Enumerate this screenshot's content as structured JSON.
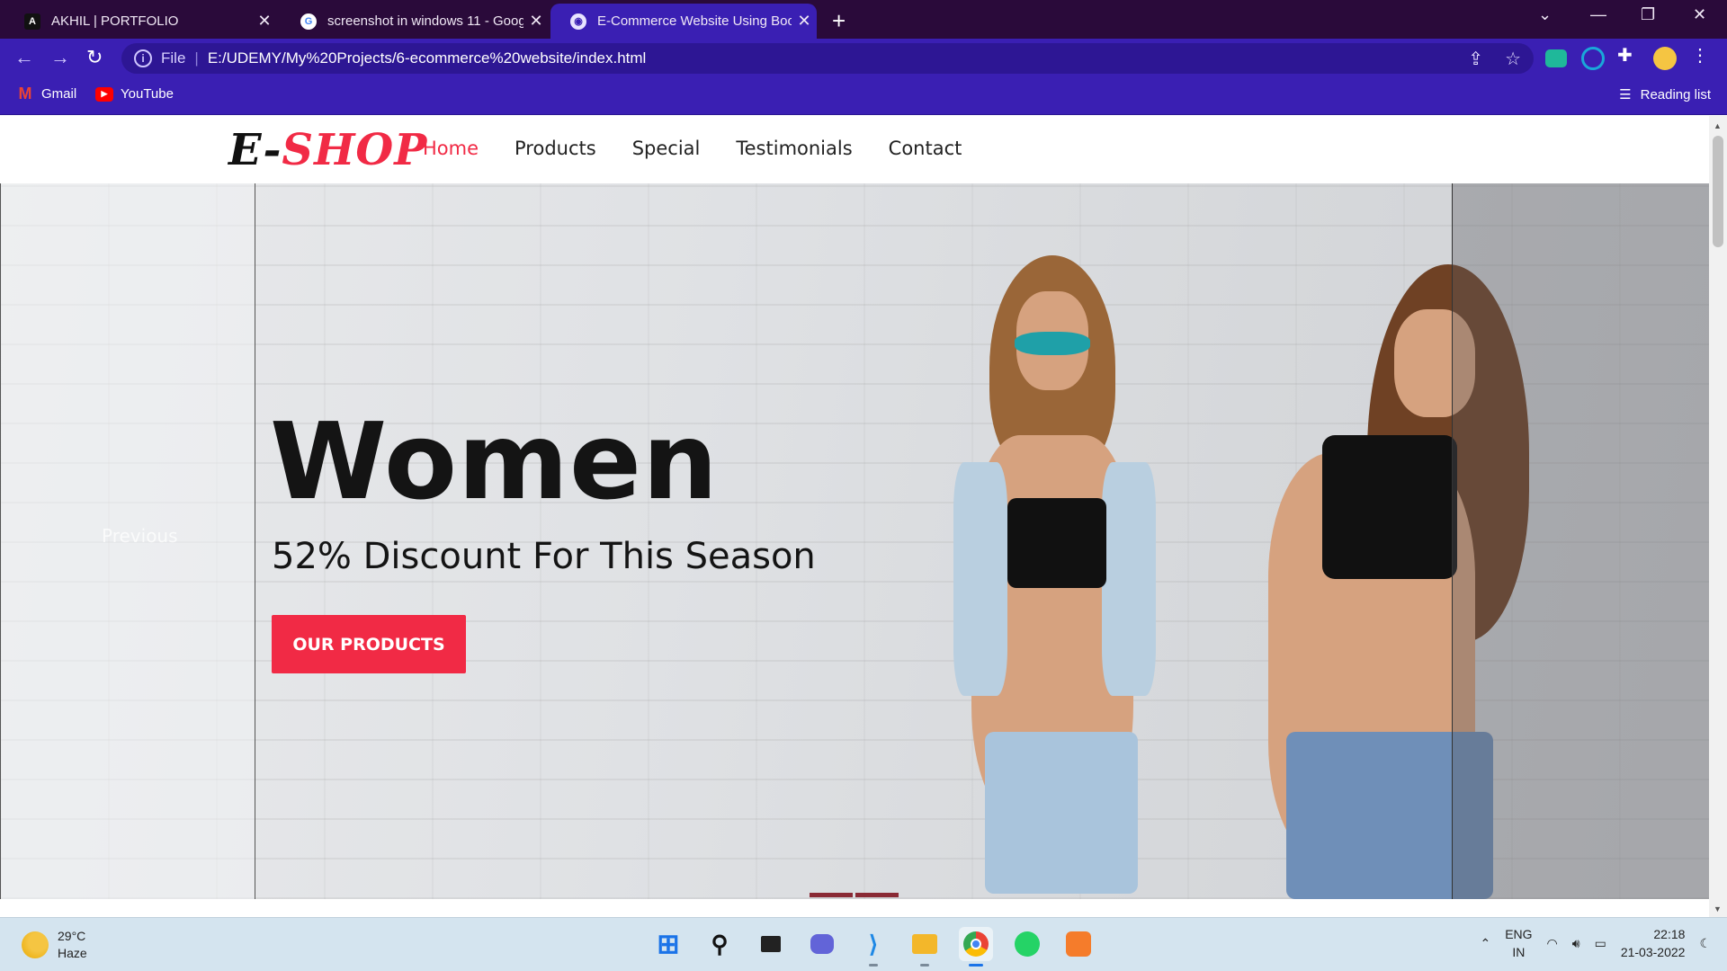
{
  "tabs": [
    {
      "title": "AKHIL | PORTFOLIO",
      "favicon": "A"
    },
    {
      "title": "screenshot in windows 11 - Goog",
      "favicon": "G"
    },
    {
      "title": "E-Commerce Website Using Boot",
      "favicon": "globe"
    }
  ],
  "address": {
    "scheme_label": "File",
    "url": "E:/UDEMY/My%20Projects/6-ecommerce%20website/index.html"
  },
  "bookmarks": [
    {
      "label": "Gmail"
    },
    {
      "label": "YouTube"
    }
  ],
  "reading_list": "Reading list",
  "site": {
    "logo_prefix": "E-",
    "logo_suffix": "SHOP",
    "nav": [
      "Home",
      "Products",
      "Special",
      "Testimonials",
      "Contact"
    ],
    "active_nav": "Home"
  },
  "hero": {
    "title": "Women",
    "subtitle": "52% Discount For This Season",
    "button": "OUR PRODUCTS",
    "prev_label": "Previous"
  },
  "colors": {
    "accent": "#f12a45",
    "chrome": "#3a1fb3",
    "tabbar": "#2a0a3a"
  },
  "taskbar": {
    "weather_temp": "29°C",
    "weather_desc": "Haze",
    "lang1": "ENG",
    "lang2": "IN",
    "time": "22:18",
    "date": "21-03-2022",
    "apps": [
      "start-icon",
      "search-icon",
      "task-view-icon",
      "chat-icon",
      "vscode-icon",
      "file-explorer-icon",
      "chrome-icon",
      "whatsapp-icon",
      "xampp-icon"
    ]
  }
}
